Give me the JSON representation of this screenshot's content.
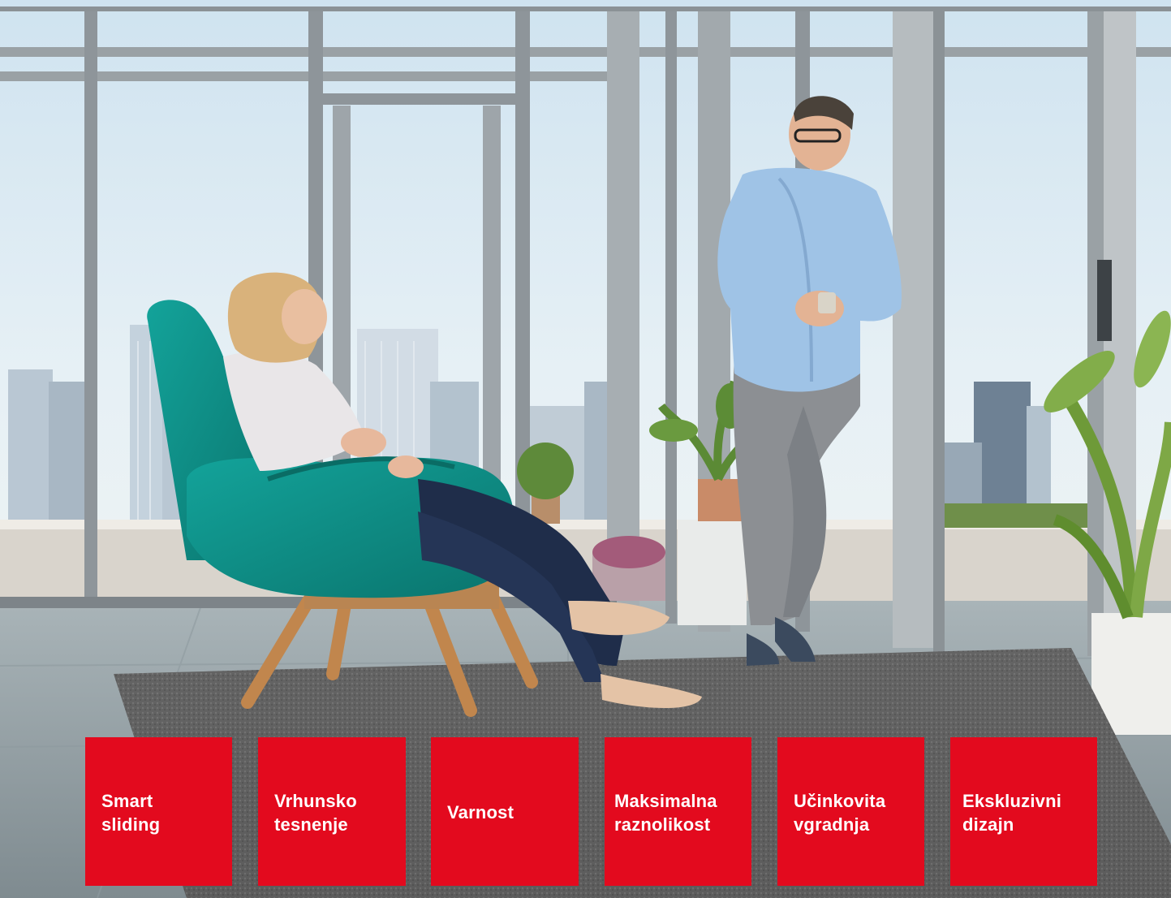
{
  "badges": [
    {
      "label": "Smart\nsliding"
    },
    {
      "label": "Vrhunsko\ntesnenje"
    },
    {
      "label": "Varnost"
    },
    {
      "label": "Maksimalna\nraznolikost"
    },
    {
      "label": "Učinkovita\nvgradnja"
    },
    {
      "label": "Ekskluzivni\ndizajn"
    }
  ],
  "colors": {
    "badge_red": "#e30a1e",
    "badge_text": "#ffffff",
    "chair_teal": "#0e8f86",
    "shirt_blue": "#9fc3e6",
    "sky": "#d9e9f3",
    "frame_gray": "#8e959a"
  }
}
